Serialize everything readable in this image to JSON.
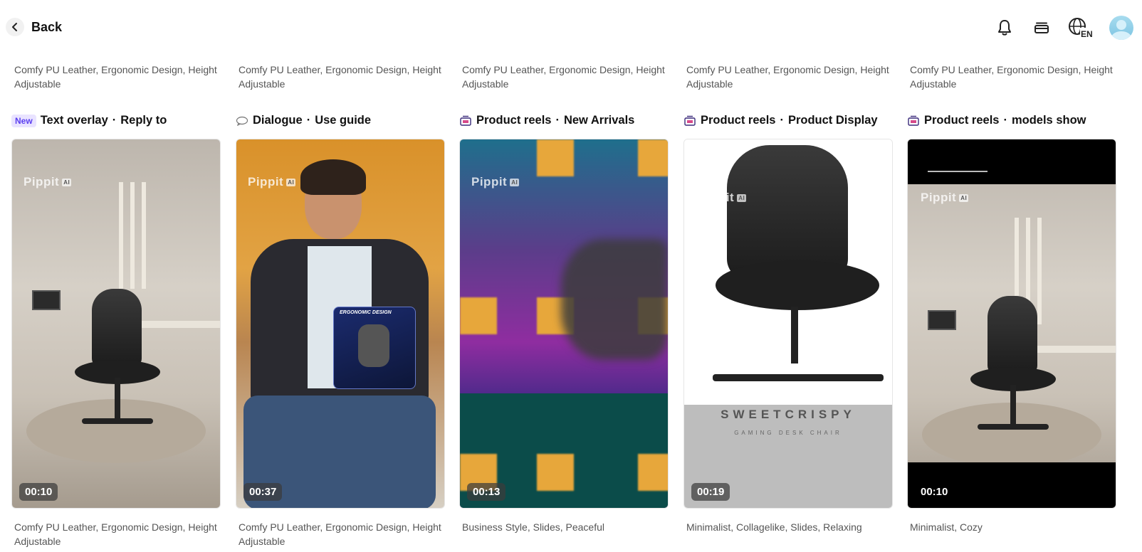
{
  "header": {
    "back_label": "Back",
    "icons": [
      "bell-icon",
      "stack-icon",
      "globe-en-icon",
      "avatar"
    ],
    "language_code": "EN"
  },
  "cards": [
    {
      "top_desc": "Comfy PU Leather, Ergonomic Design, Height Adjustable",
      "badge": "New",
      "category": "Text overlay",
      "subtitle": "Reply to",
      "watermark": "Pippit",
      "watermark_ai": "AI",
      "duration": "00:10",
      "bottom_desc": "Comfy PU Leather, Ergonomic Design, Height Adjustable"
    },
    {
      "top_desc": "Comfy PU Leather, Ergonomic Design, Height Adjustable",
      "category": "Dialogue",
      "subtitle": "Use guide",
      "watermark": "Pippit",
      "watermark_ai": "AI",
      "overlay_title": "ERGONOMIC DESIGN",
      "duration": "00:37",
      "bottom_desc": "Comfy PU Leather, Ergonomic Design, Height Adjustable"
    },
    {
      "top_desc": "Comfy PU Leather, Ergonomic Design, Height Adjustable",
      "category": "Product reels",
      "subtitle": "New Arrivals",
      "watermark": "Pippit",
      "watermark_ai": "AI",
      "duration": "00:13",
      "bottom_desc": "Business Style, Slides, Peaceful"
    },
    {
      "top_desc": "Comfy PU Leather, Ergonomic Design, Height Adjustable",
      "category": "Product reels",
      "subtitle": "Product Display",
      "watermark": "Pippit",
      "watermark_ai": "AI",
      "brand": "SWEETCRISPY",
      "brand_sub": "GAMING DESK CHAIR",
      "duration": "00:19",
      "bottom_desc": "Minimalist, Collagelike, Slides, Relaxing"
    },
    {
      "top_desc": "Comfy PU Leather, Ergonomic Design, Height Adjustable",
      "category": "Product reels",
      "subtitle": "models show",
      "watermark": "Pippit",
      "watermark_ai": "AI",
      "duration": "00:10",
      "bottom_desc": "Minimalist, Cozy"
    }
  ],
  "colors": {
    "badge_bg": "#e9e3ff",
    "badge_text": "#5b3ff0",
    "accent_purple": "#5b3ff0"
  }
}
